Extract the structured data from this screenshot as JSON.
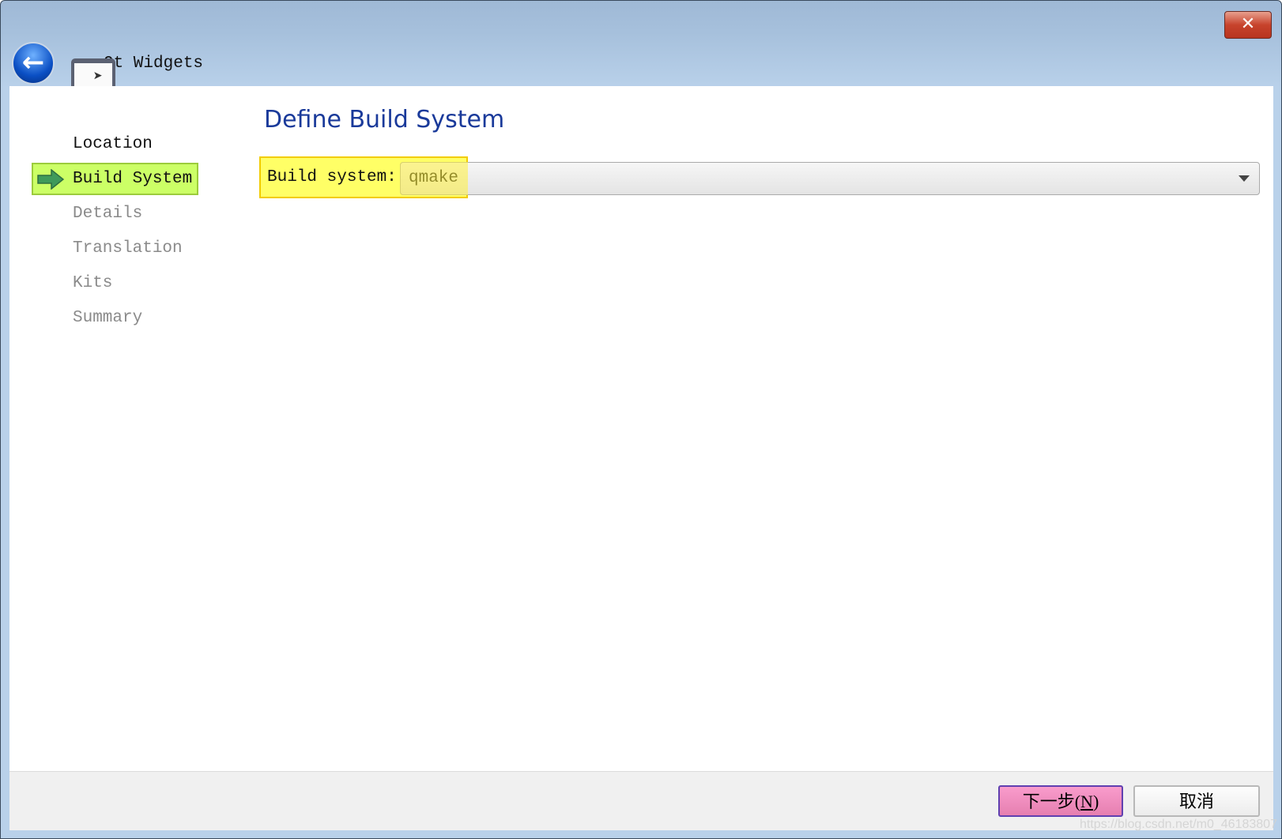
{
  "window": {
    "title": "Qt Widgets",
    "close_icon": "close-icon",
    "back_icon": "back-arrow-icon"
  },
  "sidebar": {
    "items": [
      {
        "label": "Location",
        "state": "done"
      },
      {
        "label": "Build System",
        "state": "active"
      },
      {
        "label": "Details",
        "state": "pending"
      },
      {
        "label": "Translation",
        "state": "pending"
      },
      {
        "label": "Kits",
        "state": "pending"
      },
      {
        "label": "Summary",
        "state": "pending"
      }
    ],
    "highlight_color": "#ccff66"
  },
  "main": {
    "heading": "Define Build System",
    "build_system_label": "Build system:",
    "build_system_value": "qmake",
    "highlight_color": "#ffff66"
  },
  "footer": {
    "next_label": "下一步(N)",
    "next_prefix": "下一步(",
    "next_mnemonic": "N",
    "next_suffix": ")",
    "cancel_label": "取消",
    "next_color": "#f99ccc"
  },
  "watermark": "https://blog.csdn.net/m0_46183807"
}
